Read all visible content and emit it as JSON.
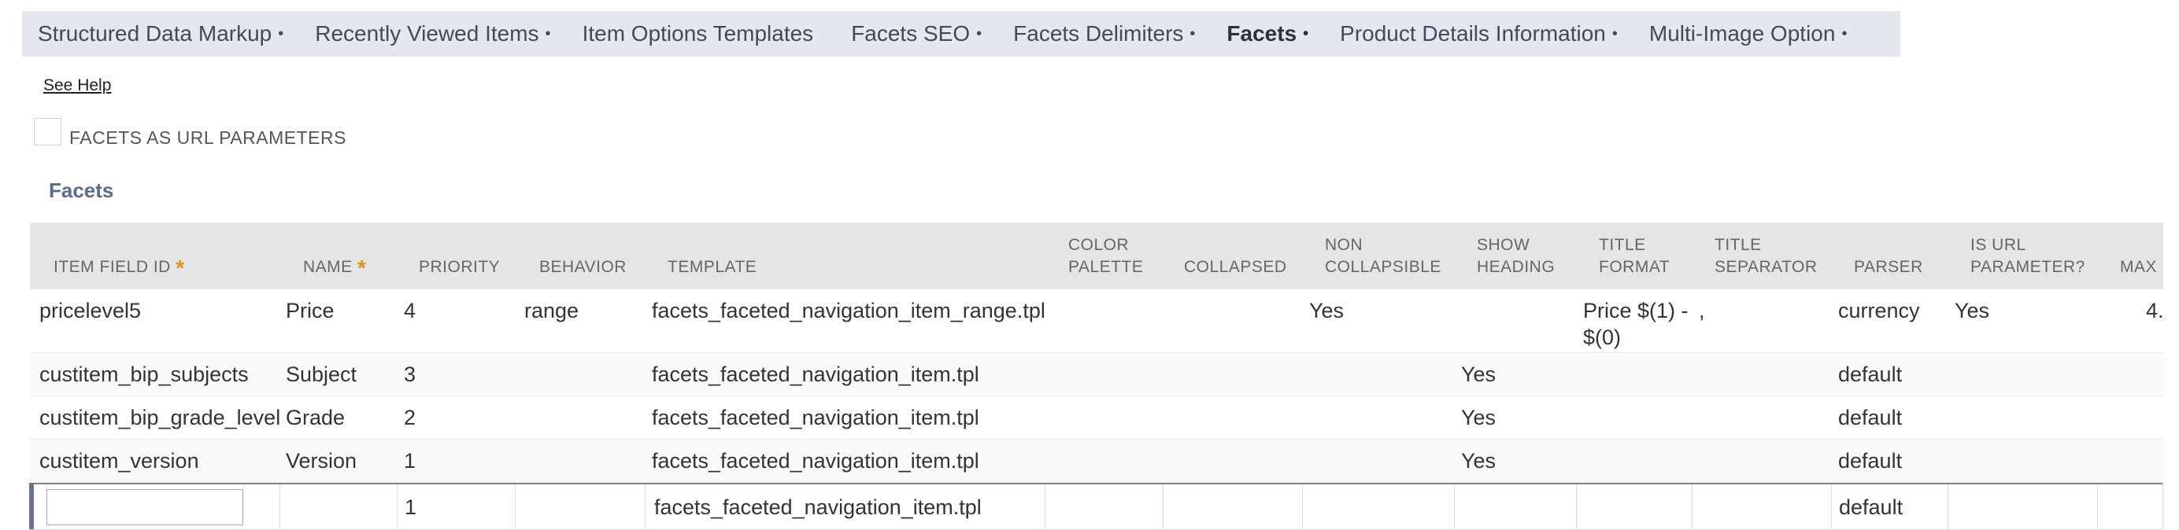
{
  "tabs": [
    {
      "label": "Structured Data Markup",
      "dot": "•",
      "active": false
    },
    {
      "label": "Recently Viewed Items",
      "dot": "•",
      "active": false
    },
    {
      "label": "Item Options Templates",
      "dot": "",
      "active": false
    },
    {
      "label": "Facets SEO",
      "dot": "•",
      "active": false
    },
    {
      "label": "Facets Delimiters",
      "dot": "•",
      "active": false
    },
    {
      "label": "Facets",
      "dot": "•",
      "active": true
    },
    {
      "label": "Product Details Information",
      "dot": "•",
      "active": false
    },
    {
      "label": "Multi-Image Option",
      "dot": "•",
      "active": false
    }
  ],
  "see_help": "See Help",
  "checkbox": {
    "label": "FACETS AS URL PARAMETERS",
    "checked": false
  },
  "section_title": "Facets",
  "required_mark": "*",
  "columns": {
    "item_field_id": "ITEM FIELD ID",
    "name": "NAME",
    "priority": "PRIORITY",
    "behavior": "BEHAVIOR",
    "template": "TEMPLATE",
    "color_palette_1": "COLOR",
    "color_palette_2": "PALETTE",
    "collapsed": "COLLAPSED",
    "non_collapsible_1": "NON",
    "non_collapsible_2": "COLLAPSIBLE",
    "show_heading_1": "SHOW",
    "show_heading_2": "HEADING",
    "title_format_1": "TITLE",
    "title_format_2": "FORMAT",
    "title_separator_1": "TITLE",
    "title_separator_2": "SEPARATOR",
    "parser": "PARSER",
    "is_url_parameter_1": "IS URL",
    "is_url_parameter_2": "PARAMETER?",
    "max": "MAX"
  },
  "rows": [
    {
      "id": "pricelevel5",
      "name": "Price",
      "priority": "4",
      "behavior": "range",
      "template": "facets_faceted_navigation_item_range.tpl",
      "non_collapsible": "Yes",
      "show_heading": "",
      "title_format_1": "Price $(1) -",
      "title_format_2": "$(0)",
      "title_separator": ",",
      "parser": "currency",
      "is_url_parameter": "Yes",
      "max": "4."
    },
    {
      "id": "custitem_bip_subjects",
      "name": "Subject",
      "priority": "3",
      "behavior": "",
      "template": "facets_faceted_navigation_item.tpl",
      "non_collapsible": "",
      "show_heading": "Yes",
      "title_format_1": "",
      "title_format_2": "",
      "title_separator": "",
      "parser": "default",
      "is_url_parameter": "",
      "max": ""
    },
    {
      "id": "custitem_bip_grade_level",
      "name": "Grade",
      "priority": "2",
      "behavior": "",
      "template": "facets_faceted_navigation_item.tpl",
      "non_collapsible": "",
      "show_heading": "Yes",
      "title_format_1": "",
      "title_format_2": "",
      "title_separator": "",
      "parser": "default",
      "is_url_parameter": "",
      "max": ""
    },
    {
      "id": "custitem_version",
      "name": "Version",
      "priority": "1",
      "behavior": "",
      "template": "facets_faceted_navigation_item.tpl",
      "non_collapsible": "",
      "show_heading": "Yes",
      "title_format_1": "",
      "title_format_2": "",
      "title_separator": "",
      "parser": "default",
      "is_url_parameter": "",
      "max": ""
    }
  ],
  "new_row": {
    "id_value": "",
    "priority": "1",
    "template": "facets_faceted_navigation_item.tpl",
    "parser": "default"
  }
}
